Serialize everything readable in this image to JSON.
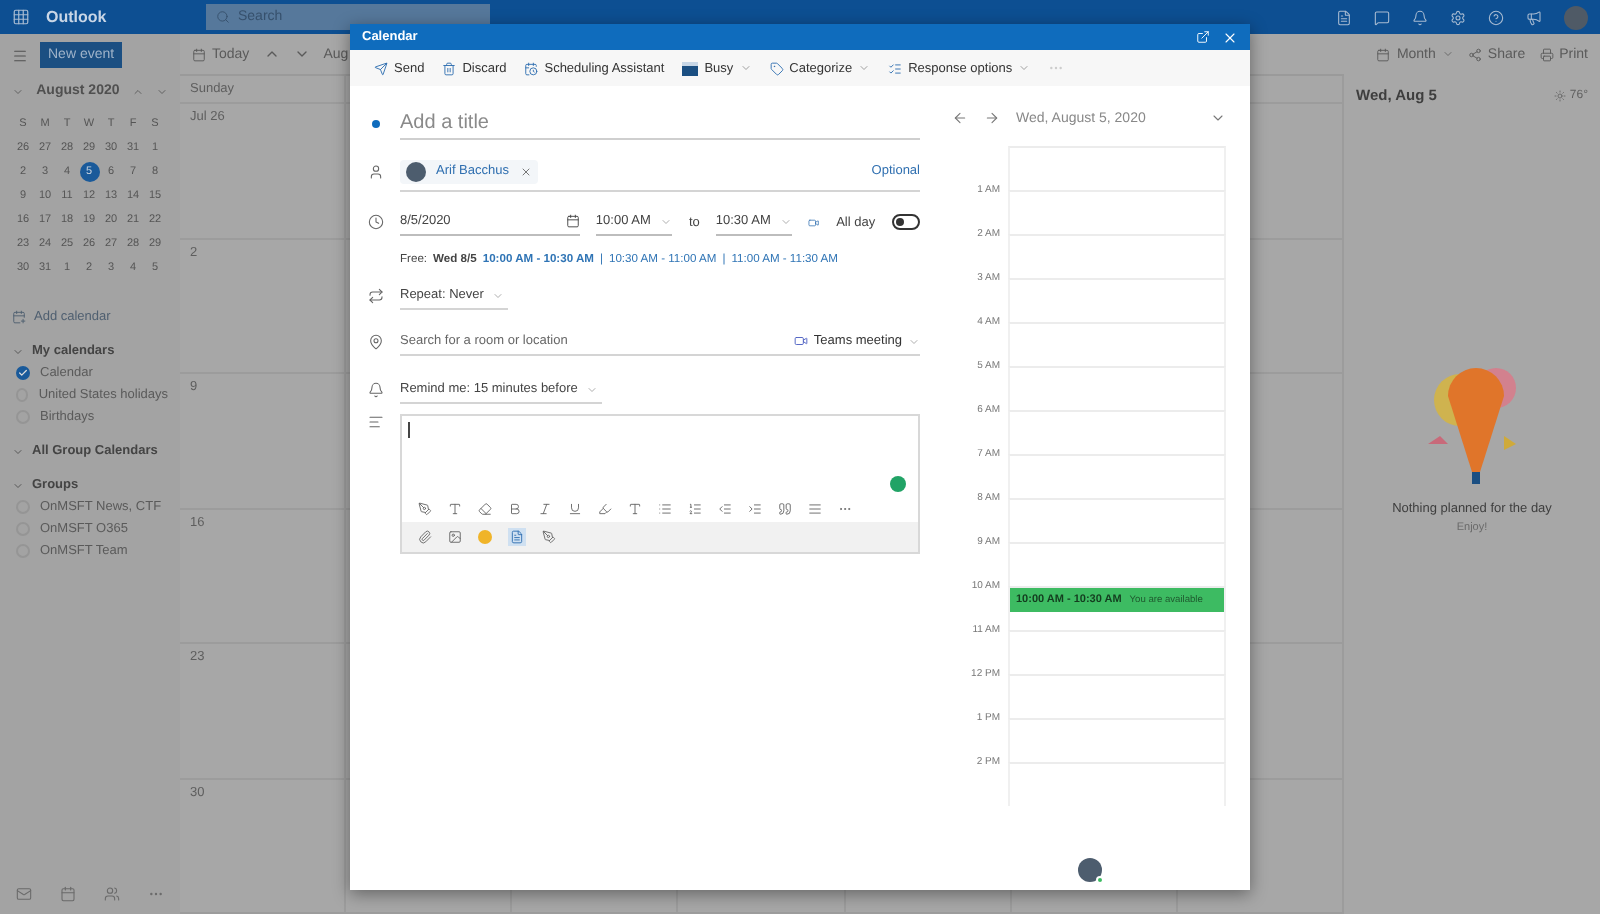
{
  "app_header": {
    "app_name": "Outlook",
    "search_placeholder": "Search"
  },
  "toolbar": {
    "new_event": "New event",
    "today": "Today",
    "month_label": "Aug",
    "view": "Month",
    "share": "Share",
    "print": "Print"
  },
  "mini_calendar": {
    "month": "August 2020",
    "weekdays": [
      "S",
      "M",
      "T",
      "W",
      "T",
      "F",
      "S"
    ],
    "weeks": [
      [
        {
          "day": "26",
          "selected": false
        },
        {
          "day": "27",
          "selected": false
        },
        {
          "day": "28",
          "selected": false
        },
        {
          "day": "29",
          "selected": false
        },
        {
          "day": "30",
          "selected": false
        },
        {
          "day": "31",
          "selected": false
        },
        {
          "day": "1",
          "selected": false
        }
      ],
      [
        {
          "day": "2",
          "selected": false
        },
        {
          "day": "3",
          "selected": false
        },
        {
          "day": "4",
          "selected": false
        },
        {
          "day": "5",
          "selected": true
        },
        {
          "day": "6",
          "selected": false
        },
        {
          "day": "7",
          "selected": false
        },
        {
          "day": "8",
          "selected": false
        }
      ],
      [
        {
          "day": "9",
          "selected": false
        },
        {
          "day": "10",
          "selected": false
        },
        {
          "day": "11",
          "selected": false
        },
        {
          "day": "12",
          "selected": false
        },
        {
          "day": "13",
          "selected": false
        },
        {
          "day": "14",
          "selected": false
        },
        {
          "day": "15",
          "selected": false
        }
      ],
      [
        {
          "day": "16",
          "selected": false
        },
        {
          "day": "17",
          "selected": false
        },
        {
          "day": "18",
          "selected": false
        },
        {
          "day": "19",
          "selected": false
        },
        {
          "day": "20",
          "selected": false
        },
        {
          "day": "21",
          "selected": false
        },
        {
          "day": "22",
          "selected": false
        }
      ],
      [
        {
          "day": "23",
          "selected": false
        },
        {
          "day": "24",
          "selected": false
        },
        {
          "day": "25",
          "selected": false
        },
        {
          "day": "26",
          "selected": false
        },
        {
          "day": "27",
          "selected": false
        },
        {
          "day": "28",
          "selected": false
        },
        {
          "day": "29",
          "selected": false
        }
      ],
      [
        {
          "day": "30",
          "selected": false
        },
        {
          "day": "31",
          "selected": false
        },
        {
          "day": "1",
          "selected": false
        },
        {
          "day": "2",
          "selected": false
        },
        {
          "day": "3",
          "selected": false
        },
        {
          "day": "4",
          "selected": false
        },
        {
          "day": "5",
          "selected": false
        }
      ]
    ]
  },
  "sidebar": {
    "add_calendar": "Add calendar",
    "sections": [
      {
        "title": "My calendars",
        "expanded": true,
        "items": [
          {
            "label": "Calendar",
            "checked": true
          },
          {
            "label": "United States holidays",
            "checked": false
          },
          {
            "label": "Birthdays",
            "checked": false
          }
        ]
      },
      {
        "title": "All Group Calendars",
        "expanded": true
      },
      {
        "title": "Groups",
        "expanded": true,
        "items": [
          {
            "label": "OnMSFT News, CTF",
            "checked": false
          },
          {
            "label": "OnMSFT O365",
            "checked": false
          },
          {
            "label": "OnMSFT Team",
            "checked": false
          }
        ]
      }
    ]
  },
  "month_view": {
    "column_header": "Sunday",
    "dates": [
      "Jul 26",
      "2",
      "9",
      "16",
      "23",
      "30"
    ]
  },
  "day_panel": {
    "date": "Wed, Aug 5",
    "weather": "76°",
    "empty_title": "Nothing planned for the day",
    "empty_subtitle": "Enjoy!"
  },
  "dialog": {
    "title": "Calendar",
    "toolbar": [
      {
        "label": "Send",
        "dropdown": false
      },
      {
        "label": "Discard",
        "dropdown": false
      },
      {
        "label": "Scheduling Assistant",
        "dropdown": false
      },
      {
        "label": "Busy",
        "dropdown": true
      },
      {
        "label": "Categorize",
        "dropdown": true
      },
      {
        "label": "Response options",
        "dropdown": true
      }
    ],
    "title_placeholder": "Add a title",
    "attendee": {
      "name": "Arif Bacchus"
    },
    "optional": "Optional",
    "start_date": "8/5/2020",
    "start_time": "10:00 AM",
    "to": "to",
    "end_time": "10:30 AM",
    "all_day": {
      "label": "All day",
      "on": false
    },
    "free": {
      "prefix": "Free:",
      "day": "Wed 8/5",
      "slots": [
        {
          "text": "10:00 AM - 10:30 AM",
          "selected": true
        },
        {
          "separator": "|",
          "text": "10:30 AM - 11:00 AM",
          "selected": false
        },
        {
          "separator": "|",
          "text": "11:00 AM - 11:30 AM",
          "selected": false
        }
      ]
    },
    "repeat": "Repeat: Never",
    "location_placeholder": "Search for a room or location",
    "teams": "Teams meeting",
    "reminder": "Remind me: 15 minutes before",
    "schedule": {
      "date": "Wed, August 5, 2020",
      "hours": [
        {
          "label": "1 AM"
        },
        {
          "label": "2 AM"
        },
        {
          "label": "3 AM"
        },
        {
          "label": "4 AM"
        },
        {
          "label": "5 AM"
        },
        {
          "label": "6 AM"
        },
        {
          "label": "7 AM"
        },
        {
          "label": "8 AM"
        },
        {
          "label": "9 AM"
        },
        {
          "label": "10 AM",
          "event": {
            "time": "10:00 AM - 10:30 AM",
            "note": "You are available"
          }
        },
        {
          "label": "11 AM"
        },
        {
          "label": "12 PM"
        },
        {
          "label": "1 PM"
        },
        {
          "label": "2 PM"
        }
      ]
    }
  }
}
